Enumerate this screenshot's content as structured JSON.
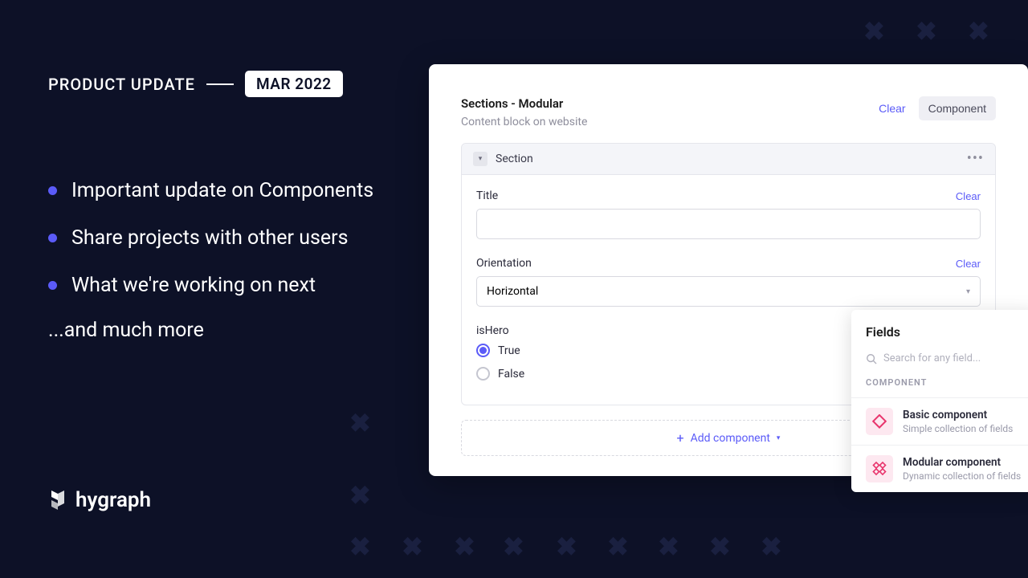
{
  "header": {
    "label": "PRODUCT UPDATE",
    "badge": "MAR 2022"
  },
  "bullets": [
    "Important update on Components",
    "Share projects with other users",
    "What we're working on next"
  ],
  "more": "...and much more",
  "brand": "hygraph",
  "panel": {
    "title": "Sections - Modular",
    "subtitle": "Content block on website",
    "clear": "Clear",
    "component_btn": "Component",
    "section_label": "Section",
    "fields": {
      "title": {
        "label": "Title",
        "clear": "Clear",
        "value": ""
      },
      "orientation": {
        "label": "Orientation",
        "clear": "Clear",
        "value": "Horizontal"
      },
      "isHero": {
        "label": "isHero",
        "options": [
          "True",
          "False"
        ],
        "selected": "True"
      }
    },
    "add_component": "Add component"
  },
  "fields_panel": {
    "title": "Fields",
    "search_placeholder": "Search for any field...",
    "section": "COMPONENT",
    "items": [
      {
        "title": "Basic component",
        "sub": "Simple collection of fields"
      },
      {
        "title": "Modular component",
        "sub": "Dynamic collection of fields"
      }
    ]
  }
}
